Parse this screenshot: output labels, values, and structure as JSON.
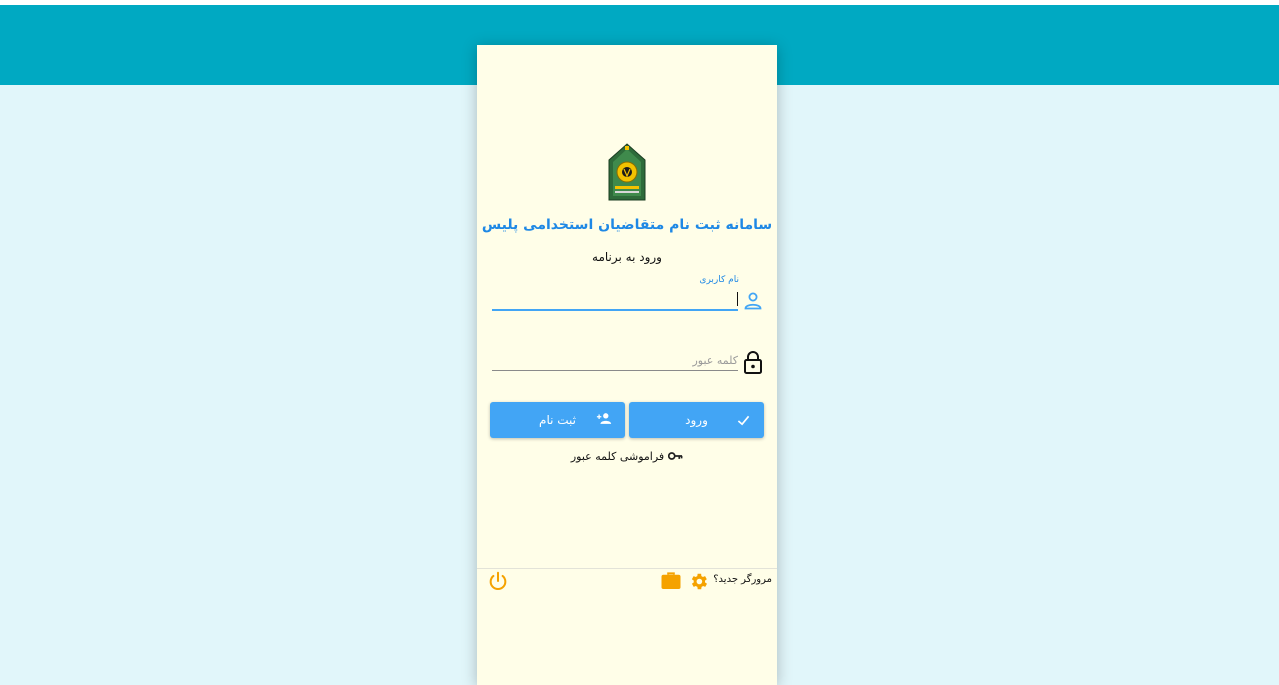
{
  "header": {
    "brand_color": "#00a9c2",
    "page_background": "#e1f6fa"
  },
  "card": {
    "background": "#fffee8",
    "logo_icon": "police-emblem-icon",
    "title": "سامانه ثبت نام متقاضیان استخدامی پلیس",
    "subtitle": "ورود به برنامه"
  },
  "form": {
    "username": {
      "label": "نام کاربری",
      "value": "",
      "icon": "user-icon"
    },
    "password": {
      "placeholder": "کلمه عبور",
      "value": "",
      "icon": "lock-icon"
    }
  },
  "buttons": {
    "login_label": "ورود",
    "login_icon": "check-icon",
    "register_label": "ثبت نام",
    "register_icon": "add-user-icon",
    "accent": "#42a5f5"
  },
  "links": {
    "forgot_password": "فراموشی کلمه عبور",
    "forgot_icon": "key-icon"
  },
  "footer": {
    "new_browser_text": "مرورگر جدید؟",
    "icons": [
      "gear-icon",
      "briefcase-icon",
      "power-icon"
    ],
    "icon_color": "#f5a200"
  }
}
